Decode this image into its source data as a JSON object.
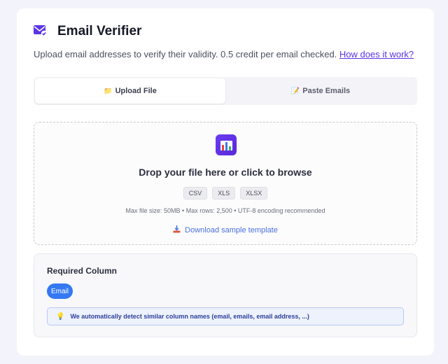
{
  "header": {
    "title": "Email Verifier",
    "subtitle": "Upload email addresses to verify their validity. 0.5 credit per email checked.",
    "help_link": "How does it work?",
    "icon": "envelope-check-icon"
  },
  "tabs": [
    {
      "label": "Upload File",
      "icon": "📁",
      "active": true
    },
    {
      "label": "Paste Emails",
      "icon": "📝",
      "active": false
    }
  ],
  "dropzone": {
    "title": "Drop your file here or click to browse",
    "formats": [
      "CSV",
      "XLS",
      "XLSX"
    ],
    "limits": "Max file size: 50MB • Max rows: 2,500 • UTF-8 encoding recommended",
    "download_label": "Download sample template",
    "icon": "bar-chart-icon"
  },
  "required": {
    "title": "Required Column",
    "column": "Email",
    "hint": "We automatically detect similar column names (email, emails, email address, ...)"
  },
  "colors": {
    "accent": "#5b34e8",
    "pill": "#3478f2",
    "link": "#4b6fe0"
  }
}
